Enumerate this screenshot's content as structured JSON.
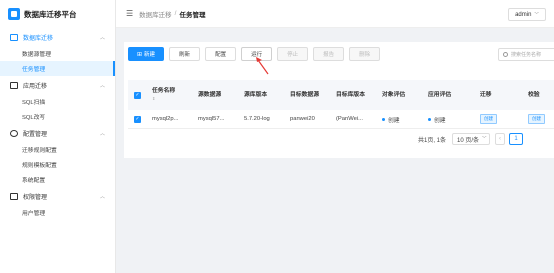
{
  "app": {
    "title": "数据库迁移平台"
  },
  "sidebar": {
    "groups": [
      {
        "label": "数据库迁移",
        "items": [
          "数据源管理",
          "任务管理"
        ]
      },
      {
        "label": "应用迁移",
        "items": [
          "SQL扫描",
          "SQL改写"
        ]
      },
      {
        "label": "配置管理",
        "items": [
          "迁移规则配置",
          "规则模板配置",
          "系统配置"
        ]
      },
      {
        "label": "权限管理",
        "items": [
          "用户管理"
        ]
      }
    ],
    "selected": "任务管理"
  },
  "header": {
    "breadcrumb": [
      "数据库迁移",
      "任务管理"
    ],
    "user": "admin"
  },
  "toolbar": {
    "new_label": "新建",
    "refresh_label": "刷新",
    "config_label": "配置",
    "run_label": "运行",
    "stop_label": "停止",
    "report_label": "报告",
    "delete_label": "删除",
    "search_placeholder": "搜索任务名称"
  },
  "table": {
    "columns": [
      "任务名称",
      "源数据源",
      "源库版本",
      "目标数据源",
      "目标库版本",
      "对象评估",
      "应用评估",
      "迁移",
      "校验"
    ],
    "rows": [
      {
        "name": "mysql2p...",
        "source": "mysql57...",
        "source_version": "5.7.20-log",
        "target": "panwei20",
        "target_version": "(PanWei...",
        "object_eval": "创建",
        "app_eval": "创建",
        "migrate": "创建",
        "verify": "创建"
      }
    ]
  },
  "pagination": {
    "total": "共1页, 1条",
    "page_size": "10 页/条",
    "current_page": "1"
  },
  "colors": {
    "accent": "#1890ff",
    "arrow": "#e53935"
  }
}
